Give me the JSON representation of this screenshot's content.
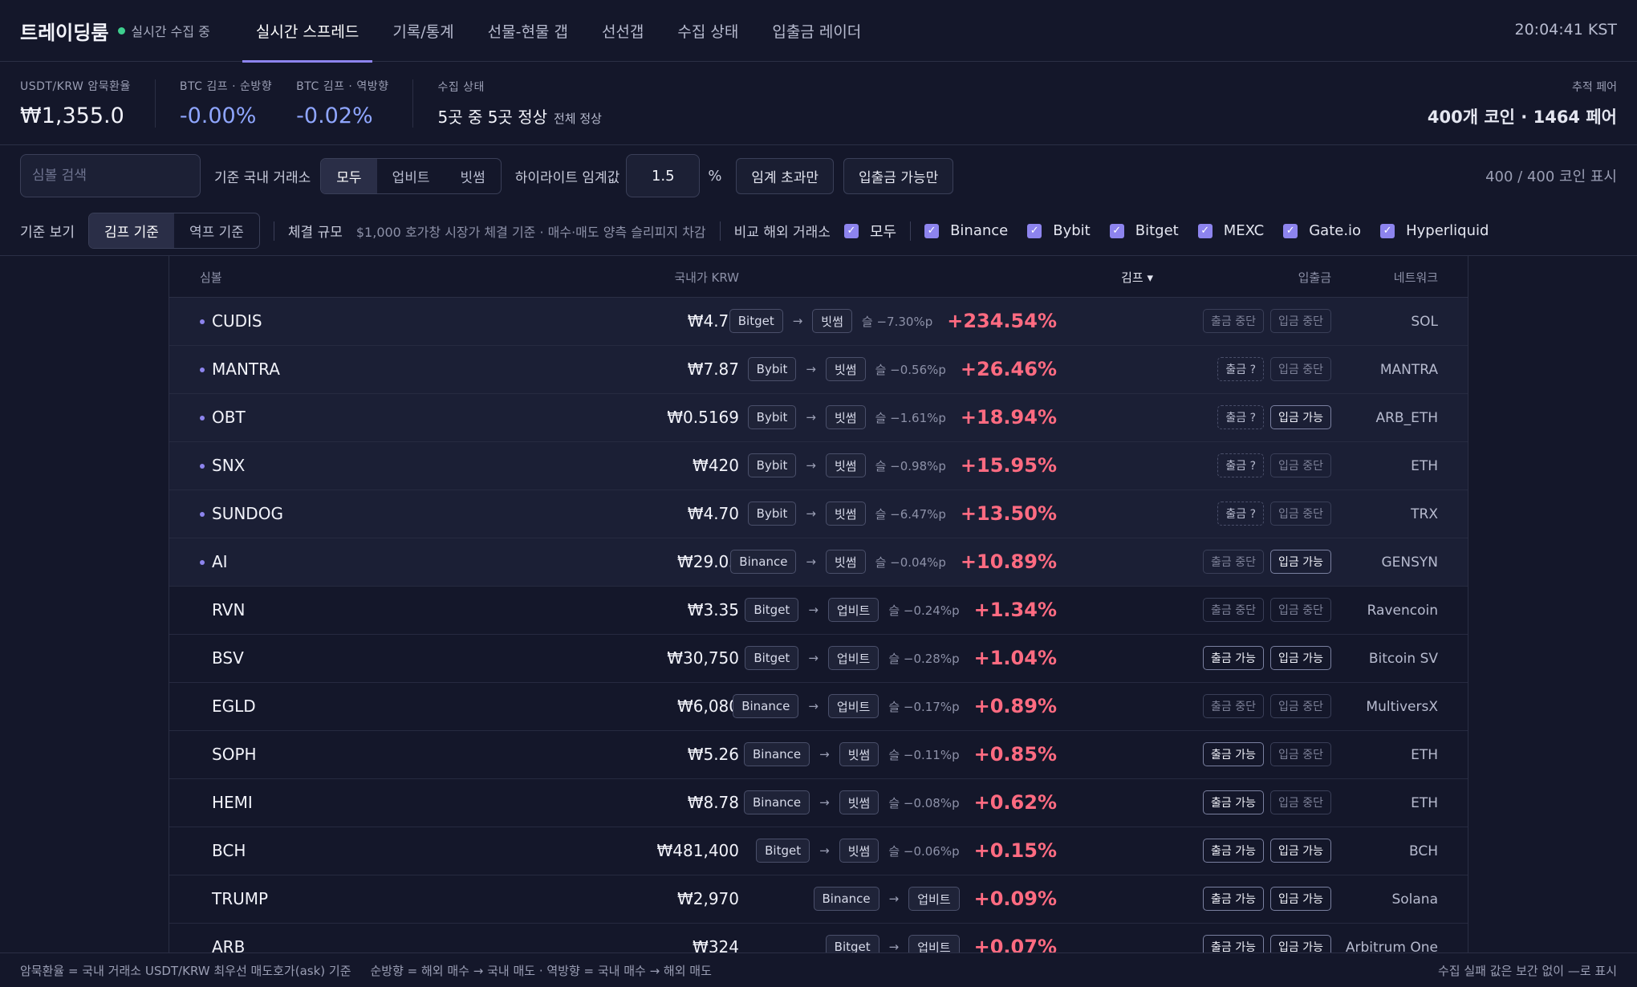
{
  "header": {
    "brand": "트레이딩룸",
    "live": "실시간 수집 중",
    "clock": "20:04:41 KST",
    "tabs": [
      "실시간 스프레드",
      "기록/통계",
      "선물-현물 갭",
      "선선갭",
      "수집 상태",
      "입출금 레이더"
    ]
  },
  "stats": {
    "usdt_label": "USDT/KRW 암묵환율",
    "usdt_value": "₩1,355.0",
    "btc_fwd_label": "BTC 김프 · 순방향",
    "btc_fwd_value": "-0.00%",
    "btc_rev_label": "BTC 김프 · 역방향",
    "btc_rev_value": "-0.02%",
    "collect_label": "수집 상태",
    "collect_value": "5곳 중 5곳 정상",
    "collect_ok": "전체 정상",
    "track_label": "추적 페어",
    "track_value": "400개 코인 · 1464 페어"
  },
  "controls": {
    "search_placeholder": "심볼 검색",
    "domestic_label": "기준 국내 거래소",
    "domestic_options": [
      "모두",
      "업비트",
      "빗썸"
    ],
    "threshold_label": "하이라이트 임계값",
    "threshold_value": "1.5",
    "pct": "%",
    "over_btn": "임계 초과만",
    "dw_btn": "입출금 가능만",
    "count": "400 / 400 코인 표시",
    "view_label": "기준 보기",
    "view_options": [
      "김프 기준",
      "역프 기준"
    ],
    "size_label": "체결 규모",
    "size_desc": "$1,000 호가창 시장가 체결 기준 · 매수·매도 양측 슬리피지 차감",
    "foreign_label": "비교 해외 거래소",
    "foreign_all": "모두",
    "foreign": [
      "Binance",
      "Bybit",
      "Bitget",
      "MEXC",
      "Gate.io",
      "Hyperliquid"
    ]
  },
  "table": {
    "headers": {
      "symbol": "심볼",
      "price": "국내가 KRW",
      "gimp": "김프 ▾",
      "dw": "입출금",
      "network": "네트워크"
    },
    "arrow": "→",
    "rows": [
      {
        "sym": "CUDIS",
        "price": "₩4.79",
        "from": "Bitget",
        "to": "빗썸",
        "slip": "슬 −7.30%p",
        "gimp": "+234.54%",
        "w": "출금 중단",
        "w_state": "off",
        "d": "입금 중단",
        "d_state": "off",
        "net": "SOL",
        "hl": true
      },
      {
        "sym": "MANTRA",
        "price": "₩7.87",
        "from": "Bybit",
        "to": "빗썸",
        "slip": "슬 −0.56%p",
        "gimp": "+26.46%",
        "w": "출금 ?",
        "w_state": "q",
        "d": "입금 중단",
        "d_state": "off",
        "net": "MANTRA",
        "hl": true
      },
      {
        "sym": "OBT",
        "price": "₩0.5169",
        "from": "Bybit",
        "to": "빗썸",
        "slip": "슬 −1.61%p",
        "gimp": "+18.94%",
        "w": "출금 ?",
        "w_state": "q",
        "d": "입금 가능",
        "d_state": "on",
        "net": "ARB_ETH",
        "hl": true
      },
      {
        "sym": "SNX",
        "price": "₩420",
        "from": "Bybit",
        "to": "빗썸",
        "slip": "슬 −0.98%p",
        "gimp": "+15.95%",
        "w": "출금 ?",
        "w_state": "q",
        "d": "입금 중단",
        "d_state": "off",
        "net": "ETH",
        "hl": true
      },
      {
        "sym": "SUNDOG",
        "price": "₩4.70",
        "from": "Bybit",
        "to": "빗썸",
        "slip": "슬 −6.47%p",
        "gimp": "+13.50%",
        "w": "출금 ?",
        "w_state": "q",
        "d": "입금 중단",
        "d_state": "off",
        "net": "TRX",
        "hl": true
      },
      {
        "sym": "AI",
        "price": "₩29.03",
        "from": "Binance",
        "to": "빗썸",
        "slip": "슬 −0.04%p",
        "gimp": "+10.89%",
        "w": "출금 중단",
        "w_state": "off",
        "d": "입금 가능",
        "d_state": "on",
        "net": "GENSYN",
        "hl": true
      },
      {
        "sym": "RVN",
        "price": "₩3.35",
        "from": "Bitget",
        "to": "업비트",
        "slip": "슬 −0.24%p",
        "gimp": "+1.34%",
        "w": "출금 중단",
        "w_state": "off",
        "d": "입금 중단",
        "d_state": "off",
        "net": "Ravencoin",
        "hl": false
      },
      {
        "sym": "BSV",
        "price": "₩30,750",
        "from": "Bitget",
        "to": "업비트",
        "slip": "슬 −0.28%p",
        "gimp": "+1.04%",
        "w": "출금 가능",
        "w_state": "on",
        "d": "입금 가능",
        "d_state": "on",
        "net": "Bitcoin SV",
        "hl": false
      },
      {
        "sym": "EGLD",
        "price": "₩6,080",
        "from": "Binance",
        "to": "업비트",
        "slip": "슬 −0.17%p",
        "gimp": "+0.89%",
        "w": "출금 중단",
        "w_state": "off",
        "d": "입금 중단",
        "d_state": "off",
        "net": "MultiversX",
        "hl": false
      },
      {
        "sym": "SOPH",
        "price": "₩5.26",
        "from": "Binance",
        "to": "빗썸",
        "slip": "슬 −0.11%p",
        "gimp": "+0.85%",
        "w": "출금 가능",
        "w_state": "on",
        "d": "입금 중단",
        "d_state": "off",
        "net": "ETH",
        "hl": false
      },
      {
        "sym": "HEMI",
        "price": "₩8.78",
        "from": "Binance",
        "to": "빗썸",
        "slip": "슬 −0.08%p",
        "gimp": "+0.62%",
        "w": "출금 가능",
        "w_state": "on",
        "d": "입금 중단",
        "d_state": "off",
        "net": "ETH",
        "hl": false
      },
      {
        "sym": "BCH",
        "price": "₩481,400",
        "from": "Bitget",
        "to": "빗썸",
        "slip": "슬 −0.06%p",
        "gimp": "+0.15%",
        "w": "출금 가능",
        "w_state": "on",
        "d": "입금 가능",
        "d_state": "on",
        "net": "BCH",
        "hl": false
      },
      {
        "sym": "TRUMP",
        "price": "₩2,970",
        "from": "Binance",
        "to": "업비트",
        "slip": "",
        "gimp": "+0.09%",
        "w": "출금 가능",
        "w_state": "on",
        "d": "입금 가능",
        "d_state": "on",
        "net": "Solana",
        "hl": false
      },
      {
        "sym": "ARB",
        "price": "₩324",
        "from": "Bitget",
        "to": "업비트",
        "slip": "",
        "gimp": "+0.07%",
        "w": "출금 가능",
        "w_state": "on",
        "d": "입금 가능",
        "d_state": "on",
        "net": "Arbitrum One",
        "hl": false
      }
    ]
  },
  "footer": {
    "left": "암묵환율 = 국내 거래소 USDT/KRW 최우선 매도호가(ask) 기준",
    "mid": "순방향 = 해외 매수 → 국내 매도 · 역방향 = 국내 매수 → 해외 매도",
    "right": "수집 실패 값은 보간 없이 —로 표시"
  }
}
